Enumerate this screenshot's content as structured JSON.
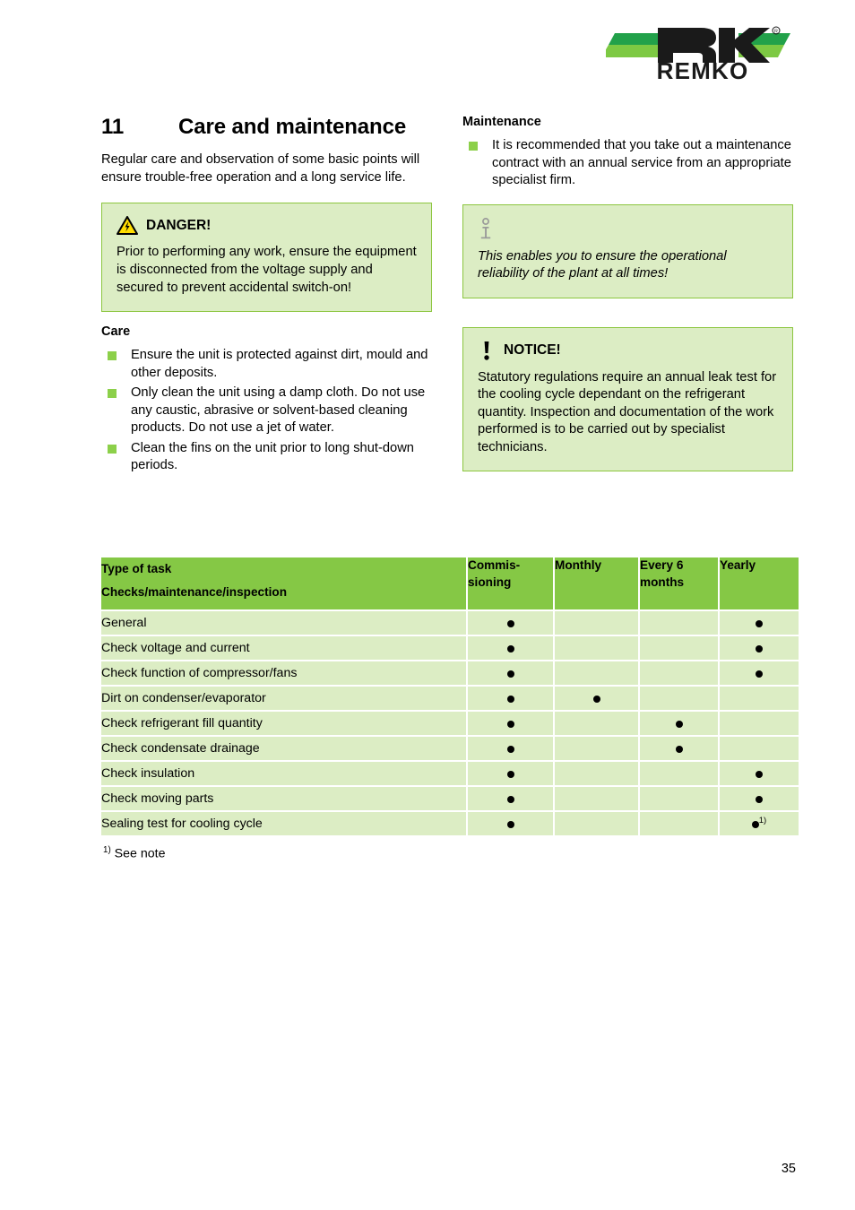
{
  "brand": {
    "logo_text": "REMKO",
    "registered_mark": "®"
  },
  "chapter": {
    "number": "11",
    "title": "Care and maintenance",
    "intro": "Regular care and observation of some basic points will ensure trouble-free operation and a long service life."
  },
  "danger_box": {
    "icon": "warning-triangle-electric-icon",
    "title": "DANGER!",
    "body": "Prior to performing any work, ensure the equipment is disconnected from the voltage supply and secured to prevent accidental switch-on!"
  },
  "care_section": {
    "heading": "Care",
    "bullets": [
      "Ensure the unit is protected against dirt, mould and other deposits.",
      "Only clean the unit using a damp cloth. Do not use any caustic, abrasive or solvent-based cleaning products. Do not use a jet of water.",
      "Clean the fins on the unit prior to long shut-down periods."
    ]
  },
  "maintenance_section": {
    "heading": "Maintenance",
    "bullets": [
      "It is recommended that you take out a maintenance contract with an annual service from an appropriate specialist firm."
    ]
  },
  "info_box": {
    "icon": "information-icon",
    "body": "This enables you to ensure the operational reliability of the plant at all times!"
  },
  "notice_box": {
    "icon": "exclamation-icon",
    "title": "NOTICE!",
    "body": "Statutory regulations require an annual leak test for the cooling cycle dependant on the refrigerant quantity. Inspection and documentation of the work performed is to be carried out by specialist technicians."
  },
  "table": {
    "headers": {
      "task_line1": "Type of task",
      "task_line2": "Checks/maintenance/inspection",
      "commissioning": "Commis-sioning",
      "monthly": "Monthly",
      "every6months": "Every 6 months",
      "yearly": "Yearly"
    },
    "rows": [
      {
        "task": "General",
        "commissioning": "dot",
        "monthly": "",
        "every6months": "",
        "yearly": "dot"
      },
      {
        "task": "Check voltage and current",
        "commissioning": "dot",
        "monthly": "",
        "every6months": "",
        "yearly": "dot"
      },
      {
        "task": "Check function of compressor/fans",
        "commissioning": "dot",
        "monthly": "",
        "every6months": "",
        "yearly": "dot"
      },
      {
        "task": "Dirt on condenser/evaporator",
        "commissioning": "dot",
        "monthly": "dot",
        "every6months": "",
        "yearly": ""
      },
      {
        "task": "Check refrigerant fill quantity",
        "commissioning": "dot",
        "monthly": "",
        "every6months": "dot",
        "yearly": ""
      },
      {
        "task": "Check condensate drainage",
        "commissioning": "dot",
        "monthly": "",
        "every6months": "dot",
        "yearly": ""
      },
      {
        "task": "Check insulation",
        "commissioning": "dot",
        "monthly": "",
        "every6months": "",
        "yearly": "dot"
      },
      {
        "task": "Check moving parts",
        "commissioning": "dot",
        "monthly": "",
        "every6months": "",
        "yearly": "dot"
      },
      {
        "task": "Sealing test for cooling cycle",
        "commissioning": "dot",
        "monthly": "",
        "every6months": "",
        "yearly": "dot-footnote"
      }
    ],
    "footnote_marker": "1)",
    "footnote_text": "See note"
  },
  "footer": {
    "page_number": "35"
  },
  "colors": {
    "header_green": "#85c845",
    "cell_green": "#dcedc4",
    "border_green": "#8cc63f",
    "bullet_green": "#8cd04a",
    "logo_dark_green": "#22a14a",
    "logo_light_green": "#7dc943",
    "warning_yellow": "#ffdd00"
  }
}
